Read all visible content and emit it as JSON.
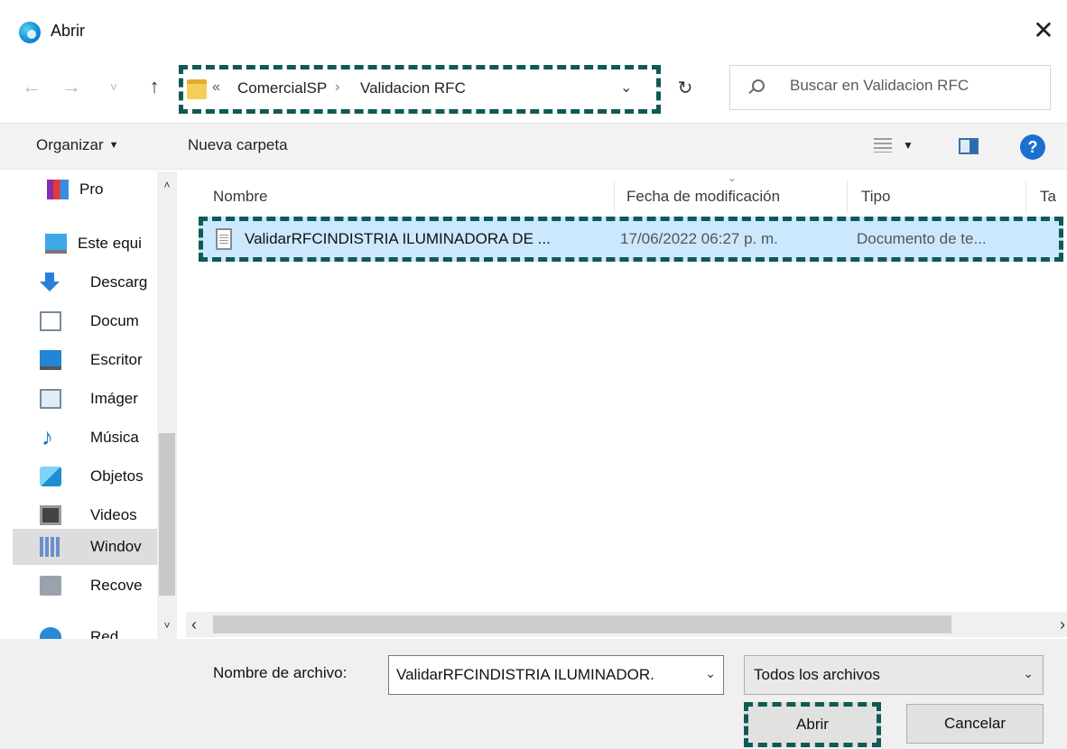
{
  "window": {
    "title": "Abrir",
    "close_glyph": "✕"
  },
  "nav": {
    "back_glyph": "←",
    "forward_glyph": "→",
    "recent_glyph": "˅",
    "up_glyph": "↑",
    "breadcrumb_sep0": "«",
    "breadcrumb": [
      "ComercialSP",
      "Validacion RFC"
    ],
    "breadcrumb_sep": "›",
    "address_drop_glyph": "⌄",
    "refresh_glyph": "↻",
    "search_placeholder": "Buscar en Validacion RFC"
  },
  "toolbar": {
    "organize": "Organizar",
    "organize_caret": "▼",
    "new_folder": "Nueva carpeta",
    "view_caret": "▼",
    "help": "?"
  },
  "navpane": {
    "items": [
      {
        "label": "Pro",
        "icon": "winrar-icon"
      },
      {
        "label": "Este equi",
        "icon": "computer-icon"
      },
      {
        "label": "Descarg",
        "icon": "downloads-icon"
      },
      {
        "label": "Docum",
        "icon": "documents-icon"
      },
      {
        "label": "Escritor",
        "icon": "desktop-icon"
      },
      {
        "label": "Imáger",
        "icon": "pictures-icon"
      },
      {
        "label": "Música",
        "icon": "music-icon"
      },
      {
        "label": "Objetos",
        "icon": "3d-objects-icon"
      },
      {
        "label": "Videos",
        "icon": "videos-icon"
      },
      {
        "label": "Windov",
        "icon": "windows-drive-icon"
      },
      {
        "label": "Recove",
        "icon": "recovery-drive-icon"
      },
      {
        "label": "Red",
        "icon": "network-icon"
      }
    ],
    "scroll_up": "˄",
    "scroll_down": "˅"
  },
  "filelist": {
    "columns": [
      "Nombre",
      "Fecha de modificación",
      "Tipo",
      "Ta"
    ],
    "sort_glyph": "⌄",
    "rows": [
      {
        "name": "ValidarRFCINDISTRIA ILUMINADORA DE ...",
        "date": "17/06/2022 06:27 p. m.",
        "type": "Documento de te..."
      }
    ],
    "scroll_left": "‹",
    "scroll_right": "›"
  },
  "footer": {
    "filename_label": "Nombre de archivo:",
    "filename_value": "ValidarRFCINDISTRIA ILUMINADOR.",
    "filename_drop": "⌄",
    "filetype_value": "Todos los archivos",
    "filetype_drop": "⌄",
    "open": "Abrir",
    "cancel": "Cancelar"
  },
  "colors": {
    "highlight": "#0f5a55",
    "selection": "#cce8ff",
    "accent": "#1d6fcf"
  }
}
